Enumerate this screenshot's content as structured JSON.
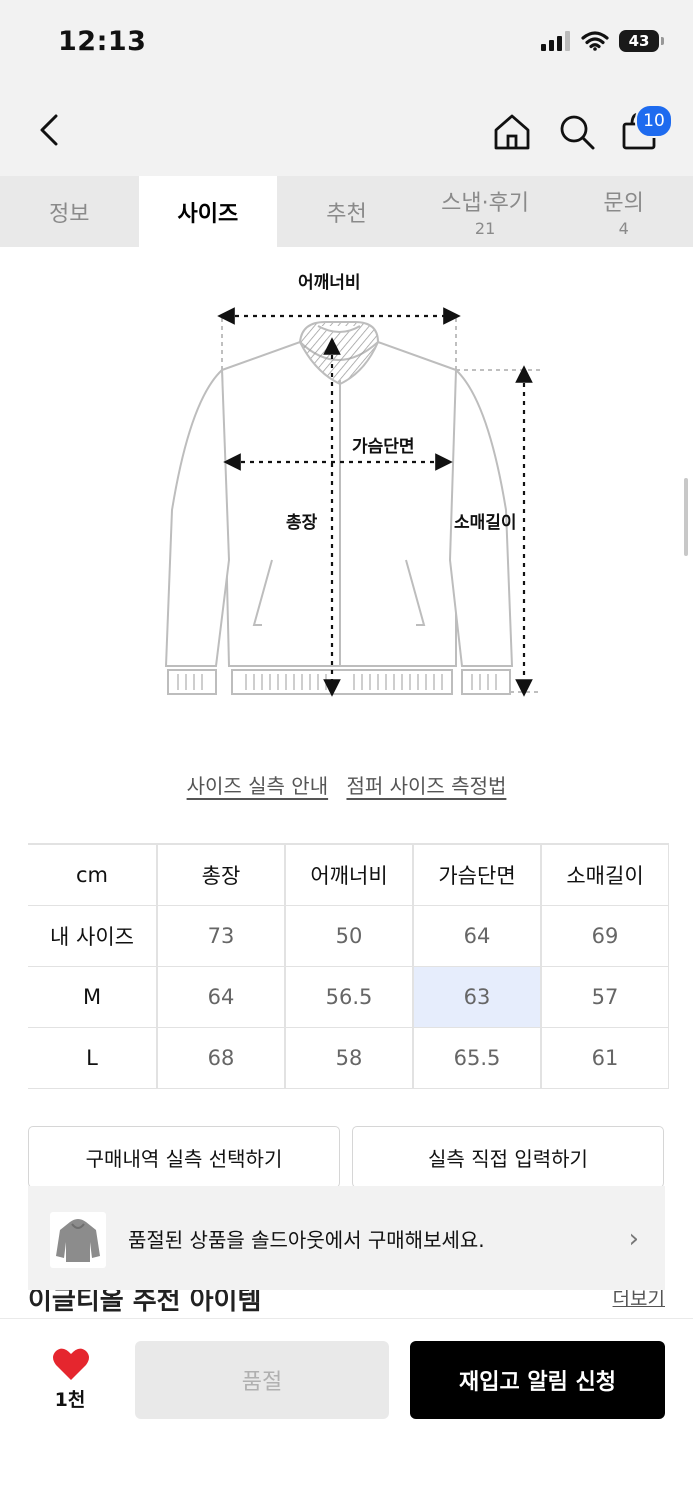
{
  "status_bar": {
    "time": "12:13",
    "battery": "43"
  },
  "header": {
    "cart_count": "10"
  },
  "tabs": [
    {
      "label": "정보",
      "count": ""
    },
    {
      "label": "사이즈",
      "count": ""
    },
    {
      "label": "추천",
      "count": ""
    },
    {
      "label": "스냅·후기",
      "count": "21"
    },
    {
      "label": "문의",
      "count": "4"
    }
  ],
  "active_tab": "사이즈",
  "diagram": {
    "shoulder_label": "어깨너비",
    "chest_label": "가슴단면",
    "length_label": "총장",
    "sleeve_label": "소매길이"
  },
  "guide_links": {
    "size_guide": "사이즈 실측 안내",
    "measure_guide": "점퍼 사이즈 측정법"
  },
  "size_table": {
    "columns": [
      "cm",
      "총장",
      "어깨너비",
      "가슴단면",
      "소매길이"
    ],
    "rows": [
      [
        "내 사이즈",
        "73",
        "50",
        "64",
        "69"
      ],
      [
        "M",
        "64",
        "56.5",
        "63",
        "57"
      ],
      [
        "L",
        "68",
        "58",
        "65.5",
        "61"
      ]
    ]
  },
  "actions": {
    "select_history": "구매내역 실측 선택하기",
    "direct_input": "실측 직접 입력하기"
  },
  "behind": {
    "title": "이글티올 추천 아이템",
    "more": "더보기"
  },
  "soldout_banner": {
    "text": "품절된 상품을 솔드아웃에서 구매해보세요."
  },
  "bottom_bar": {
    "like_count": "1천",
    "soldout_label": "품절",
    "restock_label": "재입고 알림 신청"
  },
  "colors": {
    "accent_blue": "#1e6bef",
    "highlight_cell": "#e6edfc",
    "heart_red": "#e5262e"
  }
}
